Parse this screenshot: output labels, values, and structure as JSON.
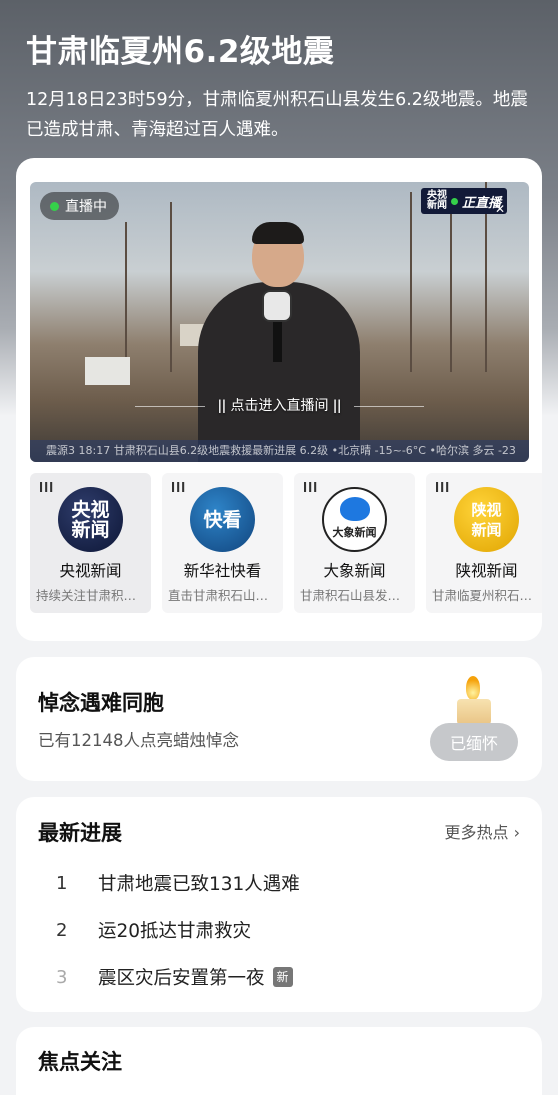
{
  "header": {
    "title": "甘肃临夏州6.2级地震",
    "description": "12月18日23时59分，甘肃临夏州积石山县发生6.2级地震。地震已造成甘肃、青海超过百人遇难。"
  },
  "live": {
    "badge": "直播中",
    "enter_label": "点击进入直播间",
    "broadcaster_logo_line1": "央视",
    "broadcaster_logo_line2": "新闻",
    "broadcaster_logo_tag": "正直播",
    "ticker": "震源3  18:17  甘肃积石山县6.2级地震救援最新进展  6.2级  •北京晴 -15~-6°C •哈尔滨 多云 -23"
  },
  "sources": [
    {
      "name": "央视新闻",
      "subtitle": "持续关注甘肃积石山县地震",
      "logo_text_1": "央视",
      "logo_text_2": "新闻",
      "icon": "cctv-news-logo"
    },
    {
      "name": "新华社快看",
      "subtitle": "直击甘肃积石山县震中",
      "logo_text_1": "快看",
      "logo_text_2": "",
      "icon": "xinhua-kuaikan-logo"
    },
    {
      "name": "大象新闻",
      "subtitle": "甘肃积石山县发生地震",
      "logo_text_1": "大象新闻",
      "logo_text_2": "",
      "icon": "daxiang-news-logo"
    },
    {
      "name": "陕视新闻",
      "subtitle": "甘肃临夏州积石山县地震",
      "logo_text_1": "陕视",
      "logo_text_2": "新闻",
      "icon": "shaanxi-tv-news-logo"
    }
  ],
  "mourn": {
    "title": "悼念遇难同胞",
    "subtitle": "已有12148人点亮蜡烛悼念",
    "button": "已缅怀"
  },
  "latest": {
    "title": "最新进展",
    "more": "更多热点",
    "items": [
      {
        "rank": "1",
        "text": "甘肃地震已致131人遇难"
      },
      {
        "rank": "2",
        "text": "运20抵达甘肃救灾"
      },
      {
        "rank": "3",
        "text": "震区灾后安置第一夜",
        "tag": "新"
      }
    ]
  },
  "focus": {
    "title": "焦点关注"
  },
  "colors": {
    "live_dot": "#35d04a",
    "mourned_button": "#c6c8cb"
  }
}
